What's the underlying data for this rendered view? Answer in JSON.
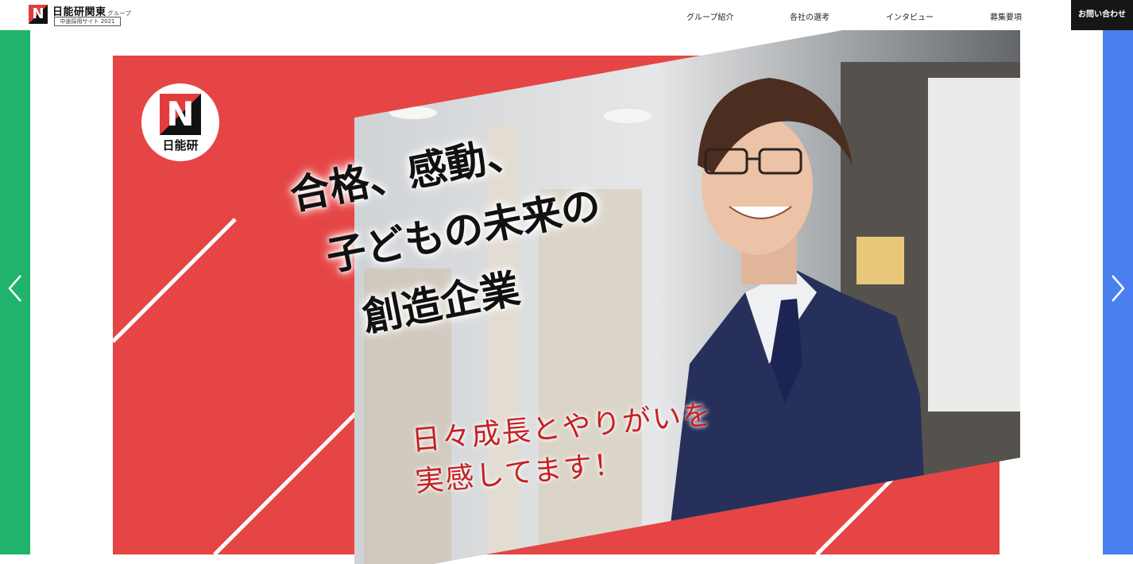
{
  "header": {
    "logo_mark": "N",
    "logo_name": "日能研関東",
    "logo_suffix": "グループ",
    "logo_sub": "中途採用サイト 2021"
  },
  "nav": {
    "items": [
      {
        "label": "グループ紹介"
      },
      {
        "label": "各社の選考"
      },
      {
        "label": "インタビュー"
      },
      {
        "label": "募集要項"
      }
    ],
    "contact_label": "お問い合わせ"
  },
  "hero": {
    "badge_mark": "N",
    "badge_label": "日能研",
    "headline": [
      "合格、感動、",
      "子どもの未来の",
      "創造企業"
    ],
    "tagline": [
      "日々成長とやりがいを",
      "実感してます！"
    ]
  },
  "slider": {
    "prev_icon": "chevron-left-icon",
    "next_icon": "chevron-right-icon"
  },
  "colors": {
    "red": "#e64545",
    "green": "#20b36c",
    "blue": "#4a7ff0",
    "dark": "#161616",
    "tagline": "#c71f23"
  }
}
